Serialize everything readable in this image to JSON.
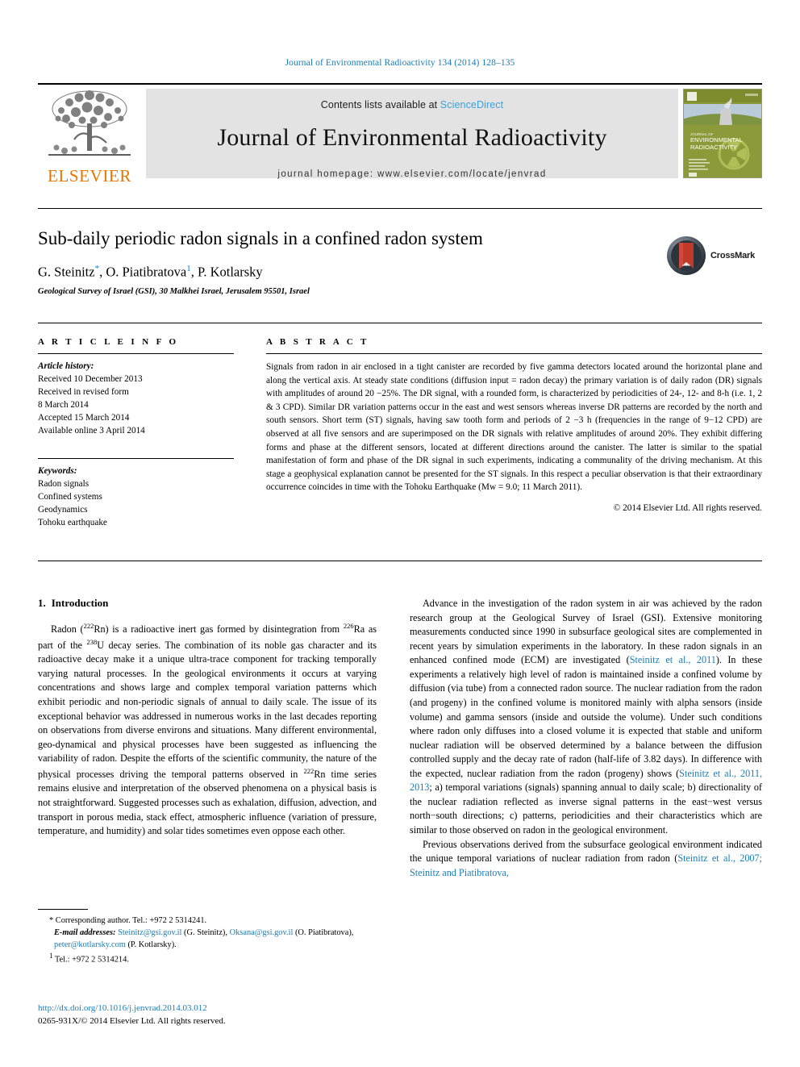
{
  "running_head": "Journal of Environmental Radioactivity 134 (2014) 128–135",
  "masthead": {
    "contents_prefix": "Contents lists available at ",
    "sciencedirect": "ScienceDirect",
    "journal_title": "Journal of Environmental Radioactivity",
    "homepage": "journal homepage: www.elsevier.com/locate/jenvrad",
    "publisher_wordmark": "ELSEVIER",
    "cover_title_line1": "JOURNAL OF",
    "cover_title_line2": "ENVIRONMENTAL",
    "cover_title_line3": "RADIOACTIVITY"
  },
  "article": {
    "title": "Sub-daily periodic radon signals in a confined radon system",
    "authors_html": "G. Steinitz, O. Piatibratova, P. Kotlarsky",
    "author1": "G. Steinitz",
    "author2": "O. Piatibratova",
    "author3": "P. Kotlarsky",
    "corresponding_marker": "*",
    "footnote_marker": "1",
    "affiliation": "Geological Survey of Israel (GSI), 30 Malkhei Israel, Jerusalem 95501, Israel",
    "crossmark_label": "CrossMark"
  },
  "article_info": {
    "heading": "A R T I C L E  I N F O",
    "history_label": "Article history:",
    "history": [
      "Received 10 December 2013",
      "Received in revised form",
      "8 March 2014",
      "Accepted 15 March 2014",
      "Available online 3 April 2014"
    ],
    "keywords_label": "Keywords:",
    "keywords": [
      "Radon signals",
      "Confined systems",
      "Geodynamics",
      "Tohoku earthquake"
    ]
  },
  "abstract": {
    "heading": "A B S T R A C T",
    "text": "Signals from radon in air enclosed in a tight canister are recorded by five gamma detectors located around the horizontal plane and along the vertical axis. At steady state conditions (diffusion input = radon decay) the primary variation is of daily radon (DR) signals with amplitudes of around 20 −25%. The DR signal, with a rounded form, is characterized by periodicities of 24-, 12- and 8-h (i.e. 1, 2 & 3 CPD). Similar DR variation patterns occur in the east and west sensors whereas inverse DR patterns are recorded by the north and south sensors. Short term (ST) signals, having saw tooth form and periods of 2 −3 h (frequencies in the range of 9−12 CPD) are observed at all five sensors and are superimposed on the DR signals with relative amplitudes of around 20%. They exhibit differing forms and phase at the different sensors, located at different directions around the canister. The latter is similar to the spatial manifestation of form and phase of the DR signal in such experiments, indicating a communality of the driving mechanism. At this stage a geophysical explanation cannot be presented for the ST signals. In this respect a peculiar observation is that their extraordinary occurrence coincides in time with the Tohoku Earthquake (Mw = 9.0; 11 March 2011).",
    "copyright": "© 2014 Elsevier Ltd. All rights reserved."
  },
  "introduction": {
    "number": "1.",
    "heading": "Introduction",
    "left_para1_a": "Radon (",
    "left_para1_sup1": "222",
    "left_para1_b": "Rn) is a radioactive inert gas formed by disintegration from ",
    "left_para1_sup2": "226",
    "left_para1_c": "Ra as part of the ",
    "left_para1_sup3": "238",
    "left_para1_d": "U decay series. The combination of its noble gas character and its radioactive decay make it a unique ultra-trace component for tracking temporally varying natural processes. In the geological environments it occurs at varying concentrations and shows large and complex temporal variation patterns which exhibit periodic and non-periodic signals of annual to daily scale. The issue of its exceptional behavior was addressed in numerous works in the last decades reporting on observations from diverse environs and situations. Many different environmental, geo-dynamical and physical processes have been suggested as influencing the variability of radon. Despite the efforts of the scientific community, the nature of the physical processes driving the temporal patterns observed in ",
    "left_para1_sup4": "222",
    "left_para1_e": "Rn time series remains elusive and interpretation of the observed phenomena on a physical basis is not straightforward. Suggested processes such as exhalation, diffusion, advection, and transport in porous media, stack effect, atmospheric influence (variation of pressure, temperature, and humidity) and solar tides sometimes even oppose each other.",
    "right_para1_a": "Advance in the investigation of the radon system in air was achieved by the radon research group at the Geological Survey of Israel (GSI). Extensive monitoring measurements conducted since 1990 in subsurface geological sites are complemented in recent years by simulation experiments in the laboratory. In these radon signals in an enhanced confined mode (ECM) are investigated (",
    "right_para1_cite1": "Steinitz et al., 2011",
    "right_para1_b": "). In these experiments a relatively high level of radon is maintained inside a confined volume by diffusion (via tube) from a connected radon source. The nuclear radiation from the radon (and progeny) in the confined volume is monitored mainly with alpha sensors (inside volume) and gamma sensors (inside and outside the volume). Under such conditions where radon only diffuses into a closed volume it is expected that stable and uniform nuclear radiation will be observed determined by a balance between the diffusion controlled supply and the decay rate of radon (half-life of 3.82 days). In difference with the expected, nuclear radiation from the radon (progeny) shows (",
    "right_para1_cite2": "Steinitz et al., 2011, 2013",
    "right_para1_c": "; a) temporal variations (signals) spanning annual to daily scale; b) directionality of the nuclear radiation reflected as inverse signal patterns in the east−west versus north−south directions; c) patterns, periodicities and their characteristics which are similar to those observed on radon in the geological environment.",
    "right_para2_a": "Previous observations derived from the subsurface geological environment indicated the unique temporal variations of nuclear radiation from radon (",
    "right_para2_cite": "Steinitz et al., 2007; Steinitz and Piatibratova,"
  },
  "footnotes": {
    "corresponding": "* Corresponding author. Tel.: +972 2 5314241.",
    "email_label": "E-mail addresses:",
    "email1": "Steinitz@gsi.gov.il",
    "email1_owner": "(G. Steinitz),",
    "email2": "Oksana@gsi.gov.il",
    "email2_owner": "(O. Piatibratova),",
    "email3": "peter@kotlarsky.com",
    "email3_owner": "(P. Kotlarsky).",
    "fn1_marker": "1",
    "fn1_text": "Tel.: +972 2 5314214."
  },
  "doi_block": {
    "doi_url": "http://dx.doi.org/10.1016/j.jenvrad.2014.03.012",
    "issn_line": "0265-931X/© 2014 Elsevier Ltd. All rights reserved."
  },
  "colors": {
    "link_blue": "#1a7db6",
    "sciencedirect_blue": "#3ba1dd",
    "elsevier_orange": "#e77500",
    "band_grey": "#e3e3e3"
  }
}
